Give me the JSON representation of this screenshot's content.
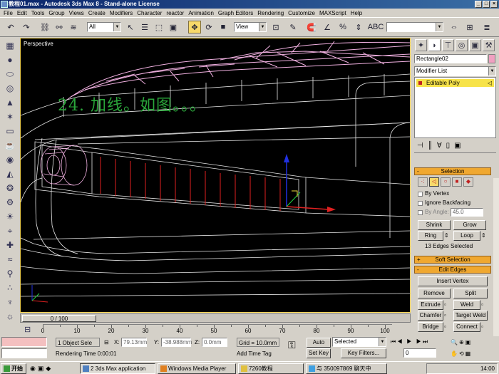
{
  "window": {
    "title": "教程01.max - Autodesk 3ds Max 8  - Stand-alone License"
  },
  "menu": [
    "File",
    "Edit",
    "Tools",
    "Group",
    "Views",
    "Create",
    "Modifiers",
    "Character",
    "reactor",
    "Animation",
    "Graph Editors",
    "Rendering",
    "Customize",
    "MAXScript",
    "Help"
  ],
  "toolbar": {
    "selection_filter": "All",
    "ref_coord": "View"
  },
  "viewport": {
    "label": "Perspective",
    "annotation": "24. 加线。如图。。。"
  },
  "timeline": {
    "slider": "0 / 100"
  },
  "ruler": {
    "ticks": [
      "0",
      "10",
      "20",
      "30",
      "40",
      "50",
      "60",
      "70",
      "80",
      "90",
      "100"
    ]
  },
  "status": {
    "selection": "1 Object Sele",
    "x_label": "X:",
    "x": "79.13mm",
    "y_label": "Y:",
    "y": "-38.988mm",
    "z_label": "Z:",
    "z": "0.0mm",
    "grid": "Grid = 10.0mm",
    "render_time": "Rendering Time  0:00:01",
    "add_time_tag": "Add Time Tag",
    "auto_key": "Auto Key",
    "set_key": "Set Key",
    "key_mode": "Selected",
    "key_filters": "Key Filters...",
    "frame": "0"
  },
  "command_panel": {
    "object_name": "Rectangle02",
    "modifier_list": "Modifier List",
    "stack": [
      "Editable Poly"
    ],
    "selection_rollout": "Selection",
    "by_vertex": "By Vertex",
    "ignore_backfacing": "Ignore Backfacing",
    "by_angle": "By Angle:",
    "angle_value": "45.0",
    "shrink": "Shrink",
    "grow": "Grow",
    "ring": "Ring",
    "loop": "Loop",
    "selection_info": "13 Edges Selected",
    "soft_selection": "Soft Selection",
    "edit_edges": "Edit Edges",
    "insert_vertex": "Insert Vertex",
    "remove": "Remove",
    "split": "Split",
    "extrude": "Extrude",
    "weld": "Weld",
    "chamfer": "Chamfer",
    "target_weld": "Target Weld",
    "bridge": "Bridge",
    "connect": "Connect"
  },
  "taskbar": {
    "start": "开始",
    "tasks": [
      "2 3ds Max application",
      "Windows Media Player",
      "7260教程",
      "与 350097869 聊天中"
    ],
    "clock": "14:00"
  },
  "colors": {
    "selection_orange": "#f0a830",
    "wire_pink": "#f0b0e0",
    "wire_white": "#e8e8e8",
    "edge_red": "#e02020",
    "annotation_green": "#2aa53a",
    "viewport_border": "#f0d050"
  }
}
